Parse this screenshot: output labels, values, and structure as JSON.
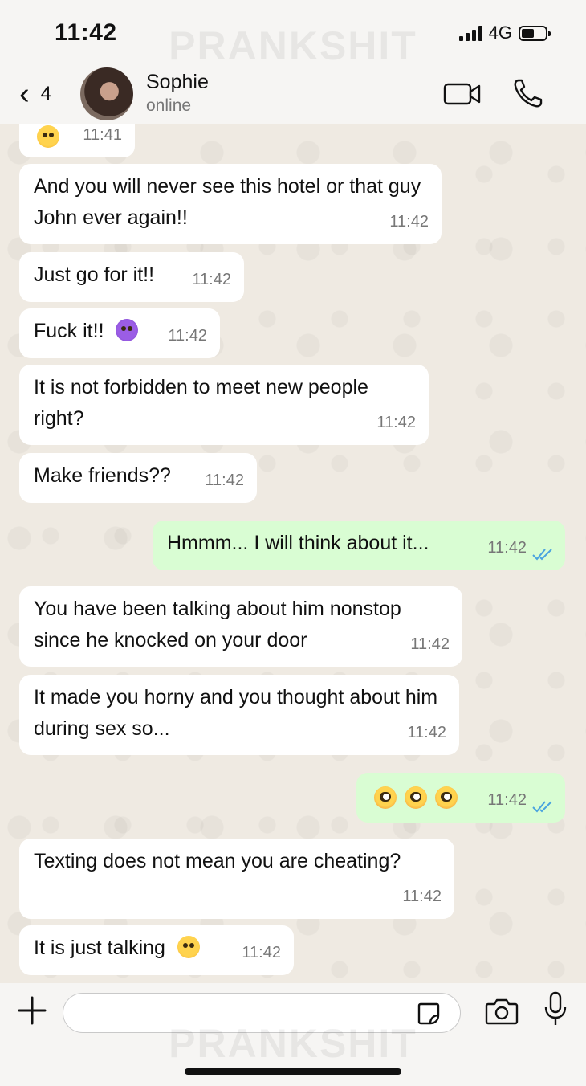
{
  "status_bar": {
    "time": "11:42",
    "network": "4G"
  },
  "watermark": "PRANKSHIT",
  "header": {
    "back_count": "4",
    "contact_name": "Sophie",
    "contact_status": "online"
  },
  "messages": [
    {
      "direction": "in",
      "text": "",
      "emoji": "winking-face",
      "time": "11:41"
    },
    {
      "direction": "in",
      "text": "And you will never see this hotel or that guy John ever again!!",
      "time": "11:42"
    },
    {
      "direction": "in",
      "text": "Just go for it!!",
      "time": "11:42"
    },
    {
      "direction": "in",
      "text": "Fuck it!!",
      "emoji": "smiling-devil",
      "time": "11:42"
    },
    {
      "direction": "in",
      "text": "It is not forbidden to meet new people right?",
      "time": "11:42"
    },
    {
      "direction": "in",
      "text": "Make friends??",
      "time": "11:42"
    },
    {
      "direction": "out",
      "text": "Hmmm... I will think about it...",
      "time": "11:42",
      "read": true
    },
    {
      "direction": "in",
      "text": "You have been talking about him nonstop since he knocked on your door",
      "time": "11:42"
    },
    {
      "direction": "in",
      "text": "It made you horny and you thought about him during sex so...",
      "time": "11:42"
    },
    {
      "direction": "out",
      "text": "",
      "emoji": "flushed-face x3",
      "time": "11:42",
      "read": true
    },
    {
      "direction": "in",
      "text": "Texting does not mean you are cheating?",
      "time": "11:42"
    },
    {
      "direction": "in",
      "text": "It is just talking",
      "emoji": "zany-face",
      "time": "11:42"
    }
  ],
  "composer": {
    "value": "",
    "placeholder": ""
  },
  "colors": {
    "incoming_bubble": "#ffffff",
    "outgoing_bubble": "#d9fdd3",
    "chat_background": "#efeae2",
    "read_ticks": "#4aa3df"
  }
}
